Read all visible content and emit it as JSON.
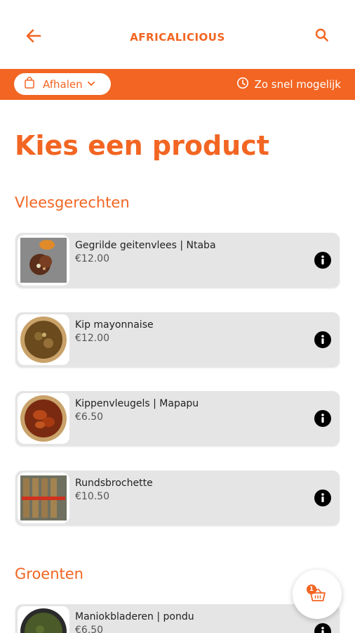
{
  "header": {
    "brand": "AFRICALICIOUS",
    "back_icon": "arrow-left-icon",
    "search_icon": "search-icon"
  },
  "bar": {
    "mode_label": "Afhalen",
    "mode_icon": "shopping-bag-icon",
    "time_label": "Zo snel mogelijk",
    "time_icon": "clock-icon"
  },
  "colors": {
    "accent": "#f26522",
    "card": "#e5e5e5"
  },
  "page_title": "Kies een product",
  "sections": [
    {
      "title": "Vleesgerechten",
      "products": [
        {
          "name": "Gegrilde geitenvlees | Ntaba",
          "price": "€12.00"
        },
        {
          "name": "Kip mayonnaise",
          "price": "€12.00"
        },
        {
          "name": "Kippenvleugels | Mapapu",
          "price": "€6.50"
        },
        {
          "name": "Rundsbrochette",
          "price": "€10.50"
        }
      ]
    },
    {
      "title": "Groenten",
      "products": [
        {
          "name": "Maniokbladeren | pondu",
          "price": "€6.50"
        }
      ]
    }
  ],
  "cart": {
    "count": "1",
    "icon": "basket-icon"
  }
}
